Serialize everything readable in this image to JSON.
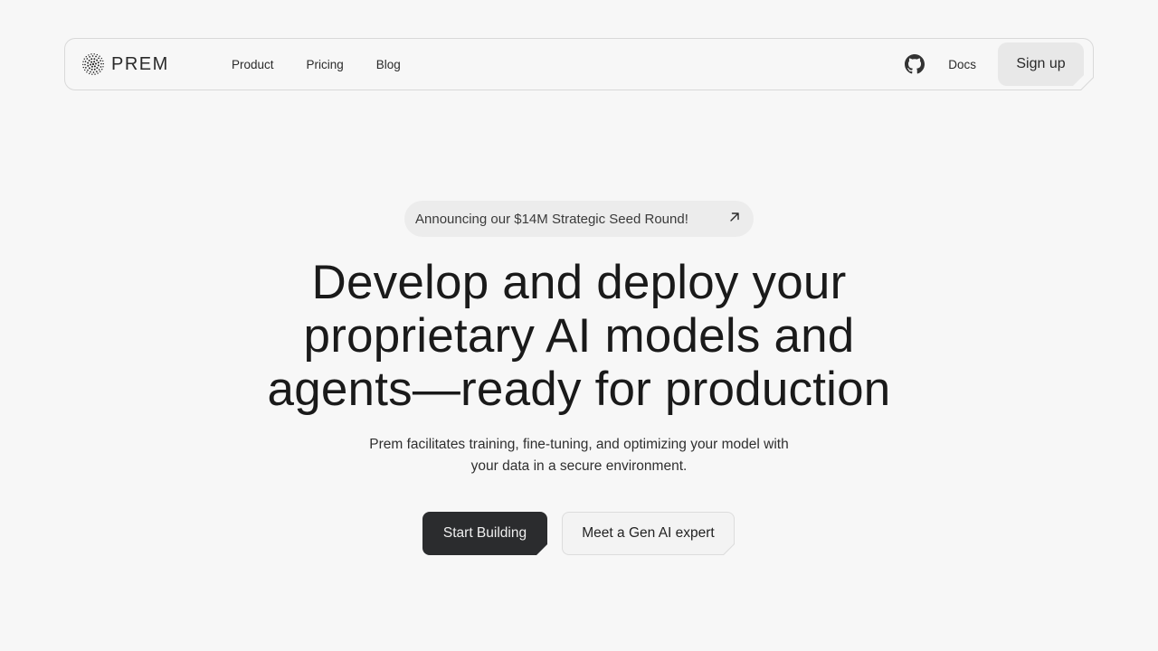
{
  "nav": {
    "logo_text": "PREM",
    "links": [
      {
        "label": "Product"
      },
      {
        "label": "Pricing"
      },
      {
        "label": "Blog"
      }
    ],
    "github_icon": "github-icon",
    "docs_label": "Docs",
    "signup_label": "Sign up"
  },
  "announcement": {
    "text": "Announcing our $14M Strategic Seed Round!",
    "icon": "arrow-up-right-icon"
  },
  "hero": {
    "title_lines": [
      "Develop and deploy your",
      "proprietary AI models and",
      "agents—ready for production"
    ],
    "subtitle_lines": [
      "Prem facilitates training, fine-tuning, and optimizing your model with",
      "your data in a secure environment."
    ],
    "primary_cta": "Start Building",
    "secondary_cta": "Meet a Gen AI expert"
  },
  "colors": {
    "background": "#f7f7f7",
    "primary_button": "#2b2c2e",
    "secondary_button": "#f3f3f3",
    "signup_button": "#e8e8e8",
    "announcement_pill": "#ececec",
    "text": "#1a1a1a"
  }
}
